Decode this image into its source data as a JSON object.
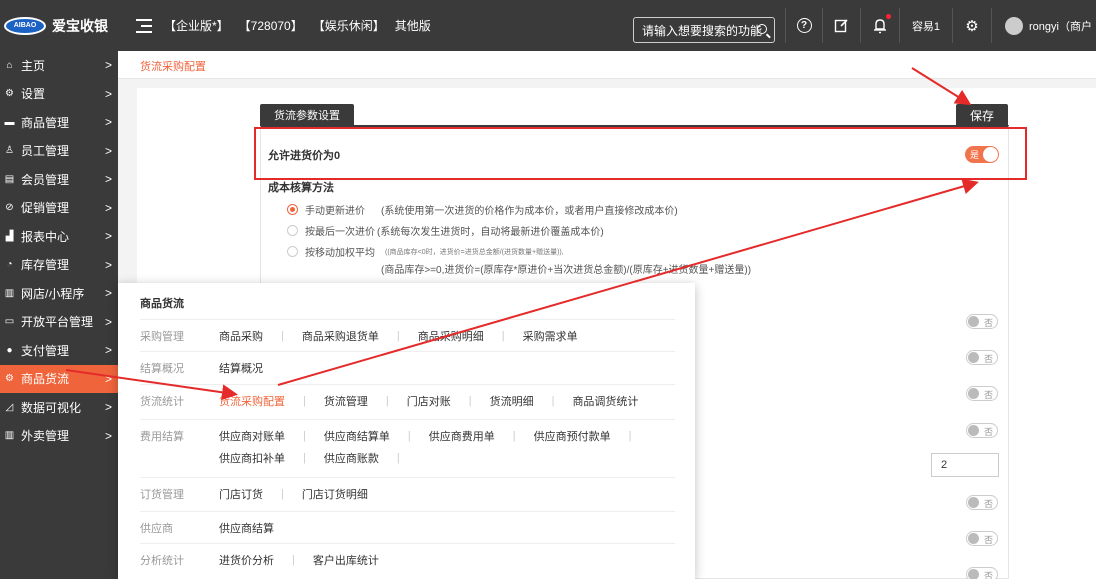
{
  "topbar": {
    "app_name": "爱宝收银",
    "logo_text": "AIBAO",
    "versions": [
      "【企业版*】",
      "【728070】",
      "【娱乐休闲】",
      "其他版"
    ],
    "search_placeholder": "请输入想要搜索的功能",
    "store_label": "容易1",
    "user_label": "rongyi（商户"
  },
  "sidebar": {
    "items": [
      {
        "label": "主页",
        "icon": "home-icon",
        "glyph": "⌂"
      },
      {
        "label": "设置",
        "icon": "gear-icon",
        "glyph": "⚙"
      },
      {
        "label": "商品管理",
        "icon": "product-icon",
        "glyph": "▬"
      },
      {
        "label": "员工管理",
        "icon": "staff-icon",
        "glyph": "♙"
      },
      {
        "label": "会员管理",
        "icon": "member-icon",
        "glyph": "▤"
      },
      {
        "label": "促销管理",
        "icon": "promotion-icon",
        "glyph": "⊘"
      },
      {
        "label": "报表中心",
        "icon": "report-icon",
        "glyph": "▟"
      },
      {
        "label": "库存管理",
        "icon": "inventory-icon",
        "glyph": "◔"
      },
      {
        "label": "网店/小程序",
        "icon": "shop-icon",
        "glyph": "▥"
      },
      {
        "label": "开放平台管理",
        "icon": "platform-icon",
        "glyph": "▭"
      },
      {
        "label": "支付管理",
        "icon": "payment-icon",
        "glyph": "●"
      },
      {
        "label": "商品货流",
        "icon": "goods-flow-icon",
        "glyph": "⚙"
      },
      {
        "label": "数据可视化",
        "icon": "chart-icon",
        "glyph": "◿"
      },
      {
        "label": "外卖管理",
        "icon": "delivery-icon",
        "glyph": "▥"
      }
    ],
    "active_index": 11
  },
  "breadcrumb": "货流采购配置",
  "settings": {
    "tab_label": "货流参数设置",
    "save_label": "保存",
    "allow_zero_label": "允许进货价为0",
    "allow_zero_toggle": "是",
    "cost_method_title": "成本核算方法",
    "methods": [
      {
        "label": "手动更新进价",
        "desc": "(系统使用第一次进货的价格作为成本价，或者用户直接修改成本价)",
        "checked": true
      },
      {
        "label": "按最后一次进价",
        "desc": "(系统每次发生进货时，自动将最新进价覆盖成本价)",
        "checked": false
      },
      {
        "label": "按移动加权平均",
        "desc": "((商品库存<0时，进货价=进货总金额/(进货数量+赠送量)),",
        "checked": false
      }
    ],
    "formula": "(商品库存>=0,进货价=(原库存*原进价+当次进货总金额)/(原库存+进货数量+赠送量))",
    "off_toggle_text": "否",
    "number_value": "2"
  },
  "mega_menu": {
    "title": "商品货流",
    "rows": [
      {
        "category": "采购管理",
        "links": [
          "商品采购",
          "商品采购退货单",
          "商品采购明细",
          "采购需求单"
        ]
      },
      {
        "category": "结算概况",
        "links": [
          "结算概况"
        ]
      },
      {
        "category": "货流统计",
        "links": [
          "货流采购配置",
          "货流管理",
          "门店对账",
          "货流明细",
          "商品调货统计"
        ],
        "active": "货流采购配置"
      },
      {
        "category": "费用结算",
        "links": [
          "供应商对账单",
          "供应商结算单",
          "供应商费用单",
          "供应商预付款单"
        ],
        "links2": [
          "供应商扣补单",
          "供应商账款"
        ]
      },
      {
        "category": "订货管理",
        "links": [
          "门店订货",
          "门店订货明细"
        ]
      },
      {
        "category": "供应商",
        "links": [
          "供应商结算"
        ]
      },
      {
        "category": "分析统计",
        "links": [
          "进货价分析",
          "客户出库统计"
        ]
      }
    ]
  },
  "colors": {
    "accent": "#f0643c",
    "dark": "#3a3a3a",
    "annotation_red": "#e52a2a"
  }
}
